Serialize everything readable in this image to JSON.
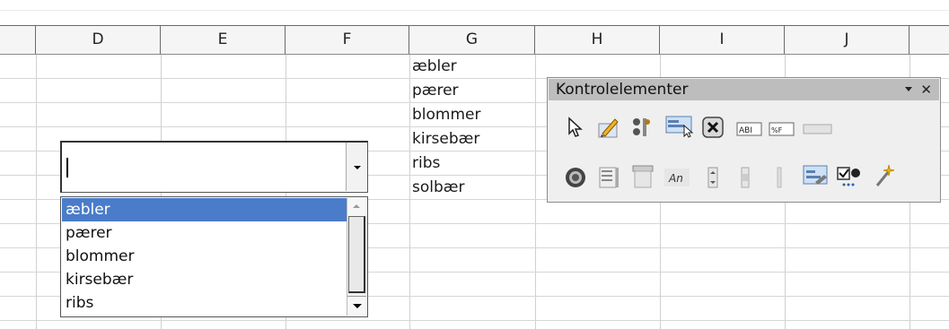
{
  "columns": [
    "D",
    "E",
    "F",
    "G",
    "H",
    "I",
    "J"
  ],
  "cells_g": [
    "æbler",
    "pærer",
    "blommer",
    "kirsebær",
    "ribs",
    "solbær"
  ],
  "combo": {
    "value": ""
  },
  "dropdown": {
    "items": [
      "æbler",
      "pærer",
      "blommer",
      "kirsebær",
      "ribs"
    ],
    "selected_index": 0
  },
  "toolbar": {
    "title": "Kontrolelementer",
    "row1": [
      "select-icon",
      "design-mode-icon",
      "control-properties-icon",
      "form-properties-icon",
      "push-button-icon",
      "text-box-icon",
      "formatted-field-icon",
      "label-icon"
    ],
    "row2": [
      "option-button-icon",
      "list-box-icon",
      "combo-box-icon",
      "label-field-icon",
      "spin-button-icon",
      "scrollbar-icon",
      "more-controls-icon",
      "form-design-icon",
      "wizard-icon"
    ]
  },
  "colors": {
    "selection": "#4a7cc9",
    "header_bg": "#f5f5f5",
    "panel_title": "#bdbdbd"
  }
}
